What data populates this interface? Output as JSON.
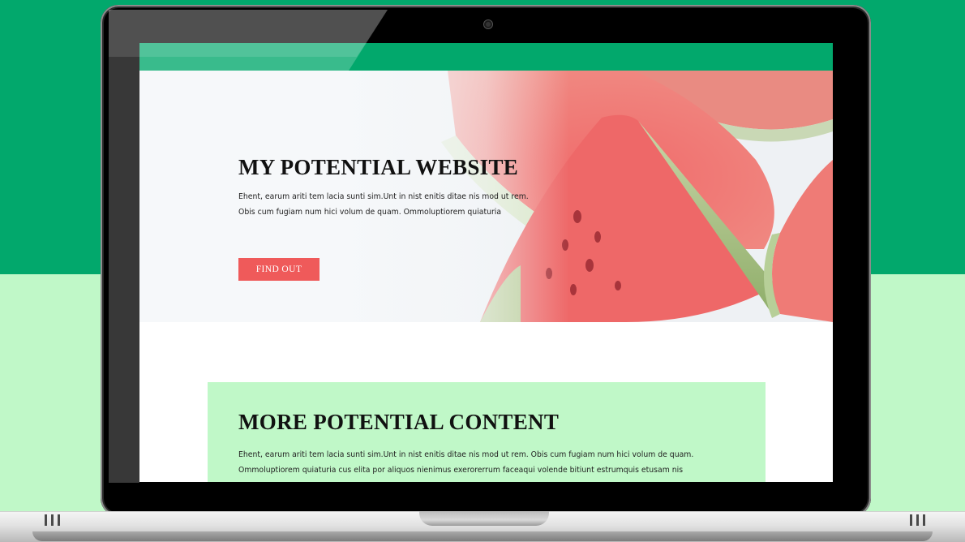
{
  "hero": {
    "title": "MY POTENTIAL WEBSITE",
    "text": "Ehent, earum ariti tem lacia sunti sim.Unt in nist enitis ditae nis mod ut rem. Obis cum fugiam num hici volum de quam. Ommoluptiorem quiaturia",
    "button_label": "FIND OUT"
  },
  "content": {
    "title": "MORE POTENTIAL CONTENT",
    "text": "Ehent, earum ariti tem lacia sunti sim.Unt in nist enitis ditae nis mod ut rem. Obis cum fugiam num hici volum de quam. Ommoluptiorem quiaturia cus elita por aliquos nienimus exerorerrum faceaqui volende bitiunt estrumquis etusam nis"
  },
  "colors": {
    "brand_green": "#02a86c",
    "light_green": "#c0f8c8",
    "button_red": "#ef5a5a"
  },
  "icons": {
    "camera": "webcam-icon",
    "hero_image": "watermelon-slices-image"
  }
}
